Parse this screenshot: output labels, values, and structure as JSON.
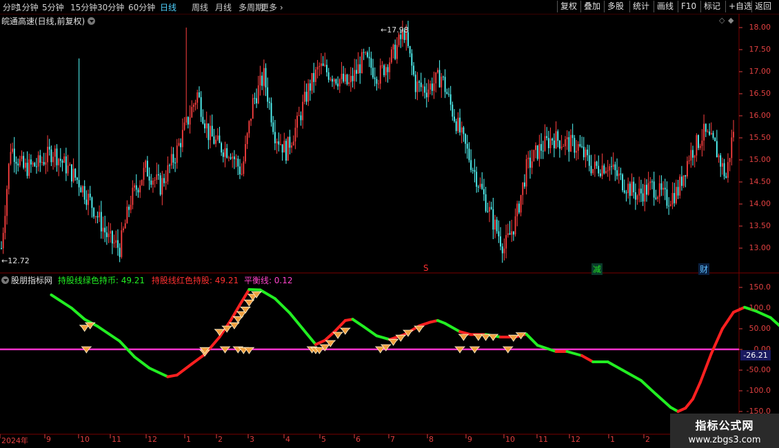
{
  "toolbar": {
    "periods": [
      "分时",
      "1分钟",
      "5分钟",
      "15分钟",
      "30分钟",
      "60分钟",
      "日线",
      "周线",
      "月线",
      "多周期",
      "更多"
    ],
    "active_period": "日线",
    "buttons": [
      "复权",
      "叠加",
      "多股",
      "统计",
      "画线",
      "F10",
      "标记",
      "+自选",
      "返回"
    ]
  },
  "stock": {
    "title": "皖通高速(日线,前复权)",
    "high_label": "17.98",
    "low_label": "12.72"
  },
  "indicator": {
    "name": "股朋指标网",
    "green_label": "持股线绿色持币: 49.21",
    "red_label": "持股线红色持股: 49.21",
    "balance_label": "平衡线: 0.12",
    "current_value_tag": "-26.21"
  },
  "event_markers": {
    "s": "S",
    "jian": "减",
    "cai": "财"
  },
  "price_axis": [
    "18.00",
    "17.50",
    "17.00",
    "16.50",
    "16.00",
    "15.50",
    "15.00",
    "14.50",
    "14.00",
    "13.50",
    "13.00"
  ],
  "ind_axis": [
    "150.0",
    "100.0",
    "50.00",
    "0.00",
    "-50.00",
    "-100.0",
    "-150.0"
  ],
  "time_axis": [
    "2024年",
    "9",
    "10",
    "11",
    "12",
    "1",
    "2",
    "3",
    "4",
    "5",
    "6",
    "7",
    "8",
    "9",
    "10",
    "11",
    "12",
    "1",
    "2"
  ],
  "watermark": {
    "line1": "指标公式网",
    "line2": "www.zbgs3.com"
  },
  "colors": {
    "up": "#ff4040",
    "down": "#54ffff",
    "green": "#22ee22",
    "red": "#ff2020",
    "balance": "#ff33cc",
    "grid": "#7a0000"
  },
  "chart_data": [
    {
      "type": "candlestick",
      "title": "皖通高速(日线,前复权)",
      "ylim": [
        12.6,
        18.2
      ],
      "y_ticks": [
        18.0,
        17.5,
        17.0,
        16.5,
        16.0,
        15.5,
        15.0,
        14.5,
        14.0,
        13.5,
        13.0
      ],
      "x_labels": [
        "2024年",
        "9",
        "10",
        "11",
        "12",
        "1",
        "2",
        "3",
        "4",
        "5",
        "6",
        "7",
        "8",
        "9",
        "10",
        "11",
        "12",
        "1",
        "2"
      ],
      "annotations": {
        "max": 17.98,
        "min": 12.72
      },
      "close_anchors": [
        [
          0,
          13.0
        ],
        [
          5,
          15.3
        ],
        [
          12,
          14.8
        ],
        [
          20,
          14.9
        ],
        [
          28,
          15.2
        ],
        [
          36,
          14.8
        ],
        [
          42,
          14.5
        ],
        [
          50,
          13.9
        ],
        [
          58,
          13.2
        ],
        [
          64,
          13.0
        ],
        [
          70,
          14.1
        ],
        [
          78,
          14.8
        ],
        [
          86,
          14.4
        ],
        [
          94,
          15.1
        ],
        [
          100,
          15.8
        ],
        [
          106,
          16.5
        ],
        [
          112,
          15.6
        ],
        [
          118,
          15.3
        ],
        [
          124,
          15.2
        ],
        [
          130,
          14.7
        ],
        [
          136,
          16.3
        ],
        [
          142,
          16.9
        ],
        [
          148,
          15.6
        ],
        [
          154,
          15.2
        ],
        [
          160,
          15.8
        ],
        [
          166,
          16.6
        ],
        [
          172,
          17.1
        ],
        [
          180,
          16.9
        ],
        [
          188,
          16.7
        ],
        [
          196,
          17.3
        ],
        [
          204,
          16.9
        ],
        [
          212,
          17.4
        ],
        [
          218,
          17.9
        ],
        [
          224,
          16.7
        ],
        [
          230,
          16.6
        ],
        [
          238,
          16.9
        ],
        [
          244,
          16.1
        ],
        [
          250,
          15.4
        ],
        [
          258,
          14.5
        ],
        [
          266,
          13.6
        ],
        [
          272,
          13.0
        ],
        [
          278,
          13.6
        ],
        [
          284,
          14.8
        ],
        [
          290,
          15.2
        ],
        [
          298,
          15.5
        ],
        [
          304,
          15.4
        ],
        [
          312,
          15.3
        ],
        [
          320,
          14.8
        ],
        [
          328,
          14.9
        ],
        [
          336,
          14.5
        ],
        [
          344,
          14.2
        ],
        [
          352,
          14.4
        ],
        [
          360,
          14.1
        ],
        [
          366,
          14.3
        ],
        [
          372,
          15.1
        ],
        [
          380,
          15.6
        ],
        [
          386,
          15.3
        ],
        [
          392,
          14.6
        ],
        [
          396,
          15.7
        ]
      ]
    },
    {
      "type": "line",
      "title": "股朋指标网",
      "series": [
        {
          "name": "持股线绿色持币",
          "color": "green"
        },
        {
          "name": "持股线红色持股",
          "color": "red"
        },
        {
          "name": "平衡线",
          "value": 0.12
        }
      ],
      "ylim": [
        -160,
        160
      ],
      "y_ticks": [
        150,
        100,
        50,
        0,
        -50,
        -100,
        -150
      ],
      "last_value": 49.21,
      "line_points": [
        [
          27,
          132,
          "g"
        ],
        [
          38,
          100,
          "g"
        ],
        [
          45,
          73,
          "g"
        ],
        [
          52,
          56,
          "g"
        ],
        [
          64,
          20,
          "g"
        ],
        [
          72,
          -18,
          "g"
        ],
        [
          80,
          -45,
          "g"
        ],
        [
          90,
          -66,
          "g"
        ],
        [
          95,
          -62,
          "r"
        ],
        [
          103,
          -35,
          "r"
        ],
        [
          110,
          -12,
          "r"
        ],
        [
          118,
          30,
          "r"
        ],
        [
          124,
          70,
          "r"
        ],
        [
          129,
          108,
          "r"
        ],
        [
          134,
          145,
          "r"
        ],
        [
          140,
          144,
          "g"
        ],
        [
          148,
          123,
          "g"
        ],
        [
          156,
          88,
          "g"
        ],
        [
          163,
          50,
          "g"
        ],
        [
          170,
          12,
          "g"
        ],
        [
          175,
          22,
          "r"
        ],
        [
          180,
          42,
          "r"
        ],
        [
          186,
          70,
          "r"
        ],
        [
          190,
          73,
          "r"
        ],
        [
          196,
          55,
          "g"
        ],
        [
          203,
          33,
          "g"
        ],
        [
          210,
          24,
          "g"
        ],
        [
          218,
          36,
          "r"
        ],
        [
          226,
          57,
          "r"
        ],
        [
          232,
          66,
          "r"
        ],
        [
          236,
          70,
          "r"
        ],
        [
          240,
          63,
          "g"
        ],
        [
          248,
          43,
          "g"
        ],
        [
          254,
          36,
          "r"
        ],
        [
          262,
          36,
          "r"
        ],
        [
          270,
          30,
          "g"
        ],
        [
          278,
          30,
          "r"
        ],
        [
          284,
          37,
          "r"
        ],
        [
          290,
          10,
          "g"
        ],
        [
          300,
          -5,
          "g"
        ],
        [
          306,
          -5,
          "r"
        ],
        [
          314,
          -15,
          "g"
        ],
        [
          320,
          -30,
          "r"
        ],
        [
          328,
          -30,
          "g"
        ],
        [
          336,
          -50,
          "g"
        ],
        [
          346,
          -75,
          "g"
        ],
        [
          354,
          -108,
          "g"
        ],
        [
          362,
          -140,
          "g"
        ],
        [
          366,
          -150,
          "g"
        ],
        [
          370,
          -142,
          "r"
        ],
        [
          374,
          -120,
          "r"
        ],
        [
          378,
          -80,
          "r"
        ],
        [
          384,
          -10,
          "r"
        ],
        [
          390,
          50,
          "r"
        ],
        [
          396,
          90,
          "r"
        ],
        [
          402,
          102,
          "r"
        ],
        [
          408,
          93,
          "g"
        ],
        [
          416,
          77,
          "g"
        ],
        [
          424,
          45,
          "g"
        ],
        [
          430,
          10,
          "g"
        ],
        [
          436,
          -15,
          "g"
        ],
        [
          442,
          -20,
          "g"
        ],
        [
          448,
          -18,
          "r"
        ],
        [
          454,
          -20,
          "r"
        ],
        [
          460,
          -22,
          "g"
        ],
        [
          466,
          -30,
          "g"
        ],
        [
          472,
          -28,
          "r"
        ],
        [
          478,
          -25,
          "r"
        ],
        [
          484,
          -22,
          "r"
        ],
        [
          490,
          -26,
          "g"
        ],
        [
          496,
          -20,
          "r"
        ],
        [
          500,
          -5,
          "r"
        ],
        [
          506,
          30,
          "r"
        ],
        [
          514,
          68,
          "r"
        ],
        [
          520,
          74,
          "r"
        ],
        [
          526,
          65,
          "g"
        ],
        [
          534,
          44,
          "g"
        ],
        [
          540,
          48,
          "r"
        ],
        [
          546,
          51,
          "r"
        ]
      ],
      "signal_markers": [
        [
          45,
          52
        ],
        [
          48,
          58
        ],
        [
          46,
          0
        ],
        [
          110,
          -8
        ],
        [
          110,
          -2
        ],
        [
          121,
          0
        ],
        [
          128,
          0
        ],
        [
          131,
          -2
        ],
        [
          134,
          -2
        ],
        [
          118,
          42
        ],
        [
          122,
          50
        ],
        [
          126,
          58
        ],
        [
          128,
          73
        ],
        [
          130,
          85
        ],
        [
          132,
          96
        ],
        [
          134,
          113
        ],
        [
          136,
          127
        ],
        [
          138,
          133
        ],
        [
          168,
          0
        ],
        [
          170,
          -2
        ],
        [
          172,
          -2
        ],
        [
          175,
          5
        ],
        [
          178,
          15
        ],
        [
          182,
          35
        ],
        [
          186,
          45
        ],
        [
          205,
          0
        ],
        [
          208,
          5
        ],
        [
          212,
          18
        ],
        [
          216,
          28
        ],
        [
          220,
          40
        ],
        [
          226,
          50
        ],
        [
          248,
          0
        ],
        [
          250,
          30
        ],
        [
          256,
          0
        ],
        [
          258,
          30
        ],
        [
          262,
          30
        ],
        [
          266,
          30
        ],
        [
          274,
          0
        ],
        [
          277,
          28
        ],
        [
          281,
          34
        ],
        [
          500,
          0
        ],
        [
          504,
          0
        ],
        [
          508,
          0
        ],
        [
          512,
          0
        ]
      ]
    }
  ]
}
